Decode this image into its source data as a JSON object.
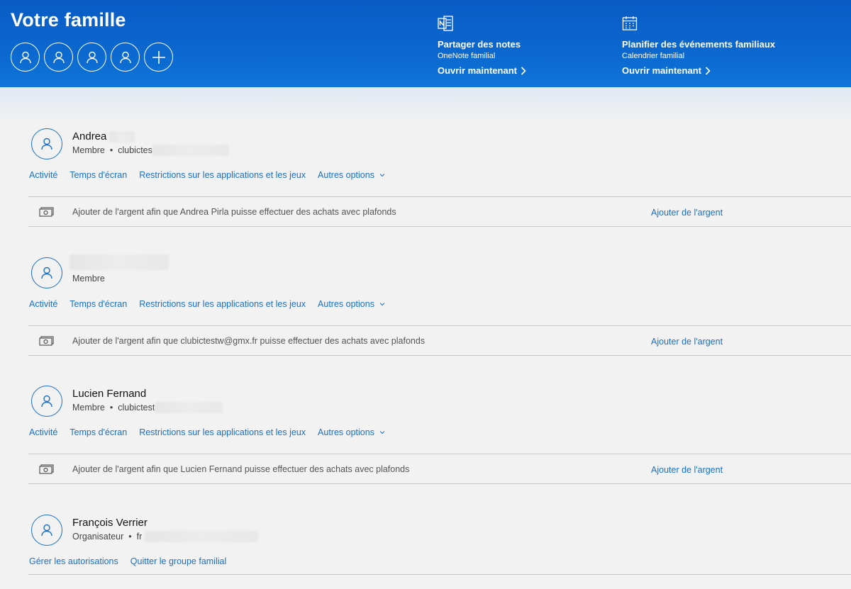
{
  "header": {
    "title": "Votre famille",
    "avatars": [
      {
        "icon": "person-icon"
      },
      {
        "icon": "person-icon"
      },
      {
        "icon": "person-icon"
      },
      {
        "icon": "person-icon"
      }
    ],
    "add_icon": "plus-icon",
    "promos": [
      {
        "icon": "onenote-icon",
        "title": "Partager des notes",
        "subtitle": "OneNote familial",
        "link": "Ouvrir maintenant"
      },
      {
        "icon": "calendar-icon",
        "title": "Planifier des événements familiaux",
        "subtitle": "Calendrier familial",
        "link": "Ouvrir maintenant"
      }
    ]
  },
  "members": [
    {
      "name": "Andrea",
      "role": "Membre",
      "account": "clubictes",
      "links": [
        "Activité",
        "Temps d'écran",
        "Restrictions sur les applications et les jeux",
        "Autres options"
      ],
      "money_text": "Ajouter de l'argent afin que Andrea Pirla puisse effectuer des achats avec plafonds",
      "money_link": "Ajouter de l'argent"
    },
    {
      "name": "",
      "role": "Membre",
      "account": "",
      "links": [
        "Activité",
        "Temps d'écran",
        "Restrictions sur les applications et les jeux",
        "Autres options"
      ],
      "money_text": "Ajouter de l'argent afin que clubictestw@gmx.fr puisse effectuer des achats avec plafonds",
      "money_link": "Ajouter de l'argent"
    },
    {
      "name": "Lucien Fernand",
      "role": "Membre",
      "account": "clubictest",
      "links": [
        "Activité",
        "Temps d'écran",
        "Restrictions sur les applications et les jeux",
        "Autres options"
      ],
      "money_text": "Ajouter de l'argent afin que Lucien Fernand puisse effectuer des achats avec plafonds",
      "money_link": "Ajouter de l'argent"
    },
    {
      "name": "François Verrier",
      "role": "Organisateur",
      "account": "fr",
      "links": [
        "Gérer les autorisations",
        "Quitter le groupe familial"
      ]
    }
  ],
  "colors": {
    "header_blue": "#0b68cf",
    "link_blue": "#1a6fc4",
    "background": "#f2f2f2"
  }
}
